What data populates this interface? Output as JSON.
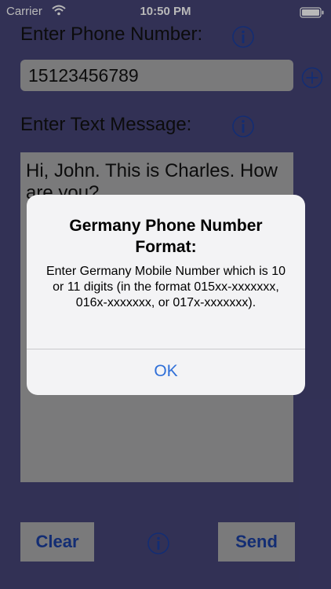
{
  "status_bar": {
    "carrier": "Carrier",
    "time": "10:50 PM"
  },
  "form": {
    "phone_label": "Enter Phone Number:",
    "phone_value": "15123456789",
    "message_label": "Enter Text Message:",
    "message_value": "Hi, John. This is Charles. How are you?"
  },
  "buttons": {
    "clear": "Clear",
    "send": "Send"
  },
  "alert": {
    "title": "Germany Phone Number Format:",
    "message": "Enter Germany Mobile Number which is 10 or 11 digits (in the format 015xx-xxxxxxx, 016x-xxxxxxx, or 017x-xxxxxxx).",
    "ok": "OK"
  },
  "icons": {
    "info": "info-icon",
    "add": "plus-circle-icon",
    "wifi": "wifi-icon",
    "battery": "battery-icon"
  },
  "colors": {
    "background": "#464477",
    "field": "#a9a9ab",
    "accent_blue": "#1b3fa0",
    "alert_button": "#2f6fd8"
  }
}
